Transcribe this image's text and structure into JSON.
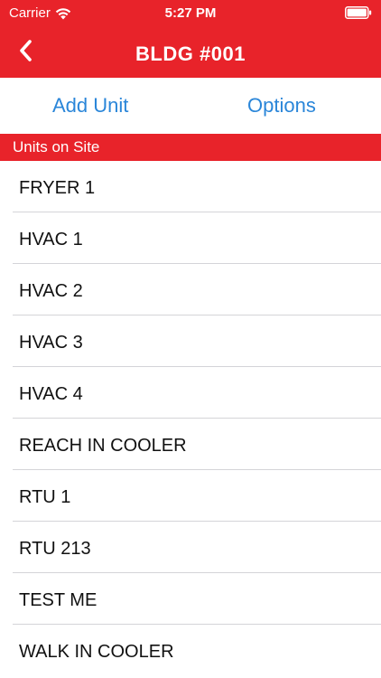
{
  "colors": {
    "brand_red": "#e8232a",
    "link_blue": "#2a86d9",
    "text_dark": "#111111",
    "white": "#ffffff"
  },
  "status_bar": {
    "carrier": "Carrier",
    "time": "5:27 PM",
    "wifi_icon": "wifi-icon",
    "battery_icon": "battery-icon"
  },
  "nav": {
    "back_icon": "chevron-left-icon",
    "title": "BLDG #001"
  },
  "actions": {
    "add_unit": "Add Unit",
    "options": "Options"
  },
  "section": {
    "title": "Units on Site"
  },
  "units": [
    "FRYER 1",
    "HVAC 1",
    "HVAC 2",
    "HVAC 3",
    "HVAC 4",
    "REACH IN COOLER",
    "RTU 1",
    "RTU 213",
    "TEST ME",
    "WALK IN COOLER"
  ]
}
